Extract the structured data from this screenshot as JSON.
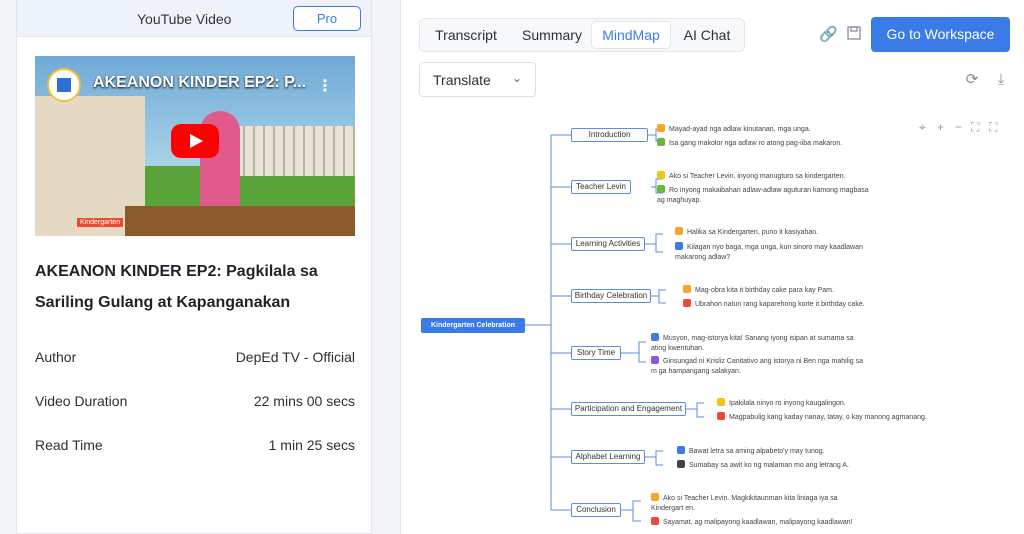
{
  "left_panel": {
    "header_title": "YouTube Video",
    "pro_label": "Pro",
    "video_overlay_title": "AKEANON KINDER EP2: P...",
    "video_badge": "Kindergarten",
    "video_title": "AKEANON KINDER EP2: Pagkilala sa Sariling Gulang at Kapanganakan",
    "meta": [
      {
        "key": "Author",
        "value": "DepEd TV - Official"
      },
      {
        "key": "Video Duration",
        "value": "22 mins 00 secs"
      },
      {
        "key": "Read Time",
        "value": "1 min 25 secs"
      }
    ]
  },
  "tabs": [
    {
      "label": "Transcript",
      "active": false
    },
    {
      "label": "Summary",
      "active": false
    },
    {
      "label": "MindMap",
      "active": true
    },
    {
      "label": "AI Chat",
      "active": false
    }
  ],
  "toolbar": {
    "workspace_label": "Go to Workspace",
    "translate_label": "Translate",
    "icons": [
      "link-icon",
      "save-icon",
      "refresh-icon",
      "download-icon"
    ]
  },
  "mindmap": {
    "root": "Kindergarten Celebration",
    "branches": [
      {
        "label": "Introduction",
        "leaves": [
          "Mayad-ayad nga adlaw kinutanan, mga unga.",
          "Isa gang makolor nga adlaw ro atong pag-iiba makaron."
        ]
      },
      {
        "label": "Teacher Levin",
        "leaves": [
          "Ako si Teacher Levin, inyong manugturo sa kindergarten.",
          "Ro inyong makaibahan adlaw-adlaw aguturan kamong magbasa ag maghuyap."
        ]
      },
      {
        "label": "Learning Activities",
        "leaves": [
          "Halika sa Kindergarten, puno it kasiyahan.",
          "Kilagan nyo baga, mga unga, kun sinoro may kaadlawan makarong adlaw?"
        ]
      },
      {
        "label": "Birthday Celebration",
        "leaves": [
          "Mag-obra kita it birthday cake para kay Pam.",
          "Ubrahon natun rang kaparehong korte it birthday cake."
        ]
      },
      {
        "label": "Story Time",
        "leaves": [
          "Musyon, mag-istorya kita! Sanang iyong isipan at sumama sa ating kwentuhan.",
          "Ginsungad ni Krisliz Canitativo ang istorya ni Ben nga mahilig sa m ga hampangang salakyan."
        ]
      },
      {
        "label": "Participation and Engagement",
        "leaves": [
          "Ipakilala ninyo ro inyong kaugalingon.",
          "Magpabulig kang kaday nanay, tatay, o kay manong agmanang."
        ]
      },
      {
        "label": "Alphabet Learning",
        "leaves": [
          "Bawat letra sa aming alpabeto'y may tunog.",
          "Sumabay sa awit ko ng malaman mo ang letrang A."
        ]
      },
      {
        "label": "Conclusion",
        "leaves": [
          "Ako si Teacher Levin. Magkikitaunman kita liniaga iya sa Kindergart en.",
          "Sayamat, ag malipayong kaadlawan, malipayong kaadlawan!"
        ]
      }
    ],
    "leaf_colors": [
      "#f5a623",
      "#6cb33f",
      "#e94b3c",
      "#3b7be8",
      "#8e5bd6",
      "#f0c419"
    ]
  }
}
